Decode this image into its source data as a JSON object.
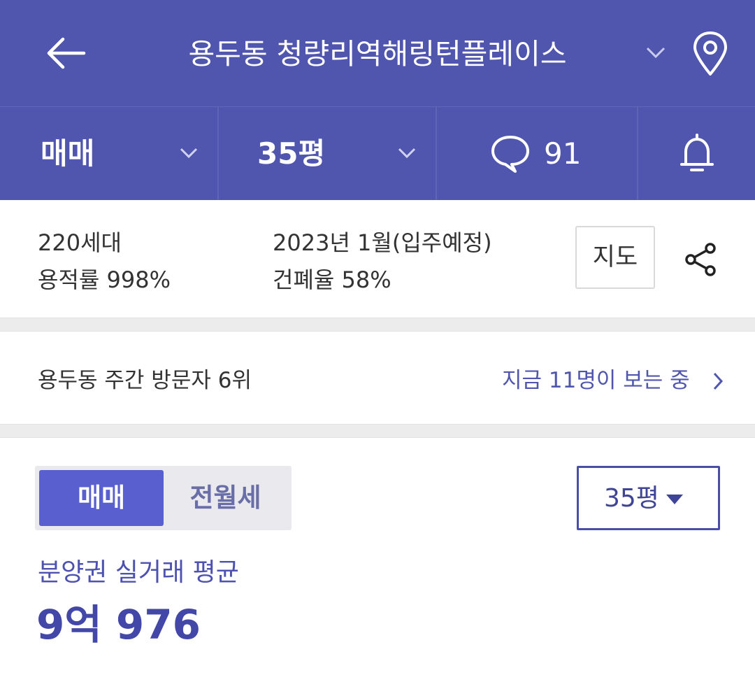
{
  "header": {
    "title": "용두동 청량리역해링턴플레이스"
  },
  "filter_bar": {
    "deal_type": "매매",
    "size": "35평",
    "comment_count": "91"
  },
  "info": {
    "households": "220세대",
    "floor_area_ratio": "용적률 998%",
    "move_in": "2023년 1월(입주예정)",
    "building_coverage": "건폐율 58%",
    "map_button": "지도"
  },
  "visitors": {
    "rank_text": "용두동 주간 방문자 6위",
    "watching_text": "지금 11명이 보는 중"
  },
  "price_section": {
    "tabs": [
      "매매",
      "전월세"
    ],
    "selected_size": "35평",
    "avg_label": "분양권 실거래 평균",
    "avg_price": "9억 976"
  },
  "colors": {
    "header_bg": "#5056ad",
    "accent": "#5a5fd0",
    "link": "#5056ad"
  },
  "icons": [
    "back-arrow-icon",
    "chevron-down-icon",
    "map-pin-icon",
    "speech-bubble-icon",
    "bell-icon",
    "share-icon",
    "chevron-right-icon",
    "caret-down-icon"
  ]
}
